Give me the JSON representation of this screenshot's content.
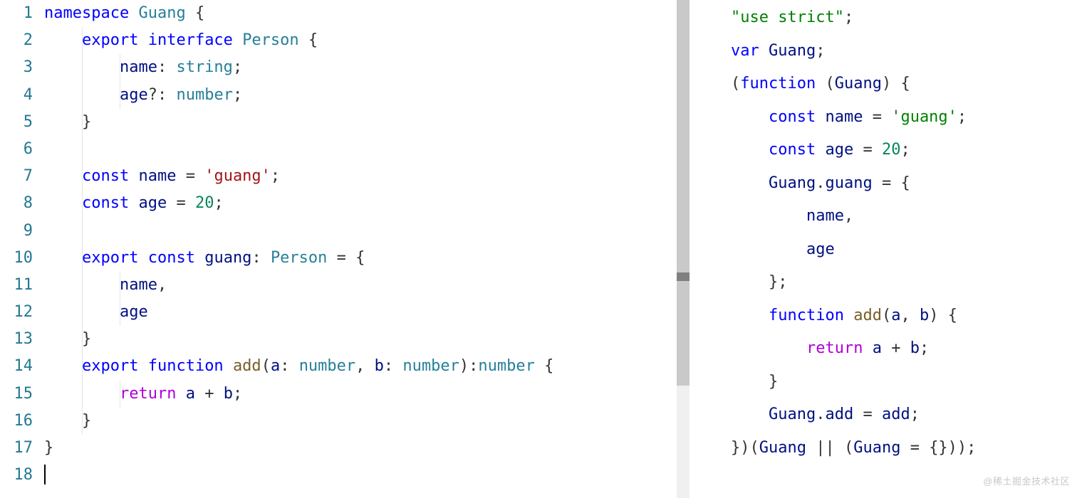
{
  "left": {
    "line_numbers": [
      "1",
      "2",
      "3",
      "4",
      "5",
      "6",
      "7",
      "8",
      "9",
      "10",
      "11",
      "12",
      "13",
      "14",
      "15",
      "16",
      "17",
      "18"
    ],
    "tokens": {
      "l1": [
        [
          "kw",
          "namespace"
        ],
        [
          "pl",
          " "
        ],
        [
          "type",
          "Guang"
        ],
        [
          "pl",
          " {"
        ]
      ],
      "l2": [
        [
          "pl",
          "    "
        ],
        [
          "kw",
          "export"
        ],
        [
          "pl",
          " "
        ],
        [
          "kw",
          "interface"
        ],
        [
          "pl",
          " "
        ],
        [
          "type",
          "Person"
        ],
        [
          "pl",
          " {"
        ]
      ],
      "l3": [
        [
          "pl",
          "        "
        ],
        [
          "id",
          "name"
        ],
        [
          "pl",
          ": "
        ],
        [
          "type",
          "string"
        ],
        [
          "pl",
          ";"
        ]
      ],
      "l4": [
        [
          "pl",
          "        "
        ],
        [
          "id",
          "age"
        ],
        [
          "pl",
          "?: "
        ],
        [
          "type",
          "number"
        ],
        [
          "pl",
          ";"
        ]
      ],
      "l5": [
        [
          "pl",
          "    }"
        ]
      ],
      "l6": [
        [
          "pl",
          ""
        ]
      ],
      "l7": [
        [
          "pl",
          "    "
        ],
        [
          "kw",
          "const"
        ],
        [
          "pl",
          " "
        ],
        [
          "id",
          "name"
        ],
        [
          "pl",
          " = "
        ],
        [
          "str",
          "'guang'"
        ],
        [
          "pl",
          ";"
        ]
      ],
      "l8": [
        [
          "pl",
          "    "
        ],
        [
          "kw",
          "const"
        ],
        [
          "pl",
          " "
        ],
        [
          "id",
          "age"
        ],
        [
          "pl",
          " = "
        ],
        [
          "num",
          "20"
        ],
        [
          "pl",
          ";"
        ]
      ],
      "l9": [
        [
          "pl",
          ""
        ]
      ],
      "l10": [
        [
          "pl",
          "    "
        ],
        [
          "kw",
          "export"
        ],
        [
          "pl",
          " "
        ],
        [
          "kw",
          "const"
        ],
        [
          "pl",
          " "
        ],
        [
          "id",
          "guang"
        ],
        [
          "pl",
          ": "
        ],
        [
          "type",
          "Person"
        ],
        [
          "pl",
          " = {"
        ]
      ],
      "l11": [
        [
          "pl",
          "        "
        ],
        [
          "id",
          "name"
        ],
        [
          "pl",
          ","
        ]
      ],
      "l12": [
        [
          "pl",
          "        "
        ],
        [
          "id",
          "age"
        ]
      ],
      "l13": [
        [
          "pl",
          "    }"
        ]
      ],
      "l14": [
        [
          "pl",
          "    "
        ],
        [
          "kw",
          "export"
        ],
        [
          "pl",
          " "
        ],
        [
          "kw",
          "function"
        ],
        [
          "pl",
          " "
        ],
        [
          "fn",
          "add"
        ],
        [
          "pl",
          "("
        ],
        [
          "id",
          "a"
        ],
        [
          "pl",
          ": "
        ],
        [
          "type",
          "number"
        ],
        [
          "pl",
          ", "
        ],
        [
          "id",
          "b"
        ],
        [
          "pl",
          ": "
        ],
        [
          "type",
          "number"
        ],
        [
          "pl",
          "):"
        ],
        [
          "type",
          "number"
        ],
        [
          "pl",
          " {"
        ]
      ],
      "l15": [
        [
          "pl",
          "        "
        ],
        [
          "cf",
          "return"
        ],
        [
          "pl",
          " "
        ],
        [
          "id",
          "a"
        ],
        [
          "pl",
          " + "
        ],
        [
          "id",
          "b"
        ],
        [
          "pl",
          ";"
        ]
      ],
      "l16": [
        [
          "pl",
          "    }"
        ]
      ],
      "l17": [
        [
          "pl",
          "}"
        ]
      ],
      "l18": [
        [
          "pl",
          ""
        ]
      ]
    }
  },
  "right": {
    "tokens": {
      "r1": [
        [
          "strg",
          "\"use strict\""
        ],
        [
          "pl",
          ";"
        ]
      ],
      "r2": [
        [
          "kw",
          "var"
        ],
        [
          "pl",
          " "
        ],
        [
          "id",
          "Guang"
        ],
        [
          "pl",
          ";"
        ]
      ],
      "r3": [
        [
          "pl",
          "("
        ],
        [
          "kw",
          "function"
        ],
        [
          "pl",
          " ("
        ],
        [
          "id",
          "Guang"
        ],
        [
          "pl",
          ") {"
        ]
      ],
      "r4": [
        [
          "pl",
          "    "
        ],
        [
          "kw",
          "const"
        ],
        [
          "pl",
          " "
        ],
        [
          "id",
          "name"
        ],
        [
          "pl",
          " = "
        ],
        [
          "strg",
          "'guang'"
        ],
        [
          "pl",
          ";"
        ]
      ],
      "r5": [
        [
          "pl",
          "    "
        ],
        [
          "kw",
          "const"
        ],
        [
          "pl",
          " "
        ],
        [
          "id",
          "age"
        ],
        [
          "pl",
          " = "
        ],
        [
          "num",
          "20"
        ],
        [
          "pl",
          ";"
        ]
      ],
      "r6": [
        [
          "pl",
          "    "
        ],
        [
          "id",
          "Guang"
        ],
        [
          "pl",
          "."
        ],
        [
          "id",
          "guang"
        ],
        [
          "pl",
          " = {"
        ]
      ],
      "r7": [
        [
          "pl",
          "        "
        ],
        [
          "id",
          "name"
        ],
        [
          "pl",
          ","
        ]
      ],
      "r8": [
        [
          "pl",
          "        "
        ],
        [
          "id",
          "age"
        ]
      ],
      "r9": [
        [
          "pl",
          "    };"
        ]
      ],
      "r10": [
        [
          "pl",
          "    "
        ],
        [
          "kw",
          "function"
        ],
        [
          "pl",
          " "
        ],
        [
          "fn",
          "add"
        ],
        [
          "pl",
          "("
        ],
        [
          "id",
          "a"
        ],
        [
          "pl",
          ", "
        ],
        [
          "id",
          "b"
        ],
        [
          "pl",
          ") {"
        ]
      ],
      "r11": [
        [
          "pl",
          "        "
        ],
        [
          "cf",
          "return"
        ],
        [
          "pl",
          " "
        ],
        [
          "id",
          "a"
        ],
        [
          "pl",
          " + "
        ],
        [
          "id",
          "b"
        ],
        [
          "pl",
          ";"
        ]
      ],
      "r12": [
        [
          "pl",
          "    }"
        ]
      ],
      "r13": [
        [
          "pl",
          "    "
        ],
        [
          "id",
          "Guang"
        ],
        [
          "pl",
          "."
        ],
        [
          "id",
          "add"
        ],
        [
          "pl",
          " = "
        ],
        [
          "id",
          "add"
        ],
        [
          "pl",
          ";"
        ]
      ],
      "r14": [
        [
          "pl",
          "})("
        ],
        [
          "id",
          "Guang"
        ],
        [
          "pl",
          " || ("
        ],
        [
          "id",
          "Guang"
        ],
        [
          "pl",
          " = {}));"
        ]
      ]
    }
  },
  "watermark": "@稀土掘金技术社区"
}
